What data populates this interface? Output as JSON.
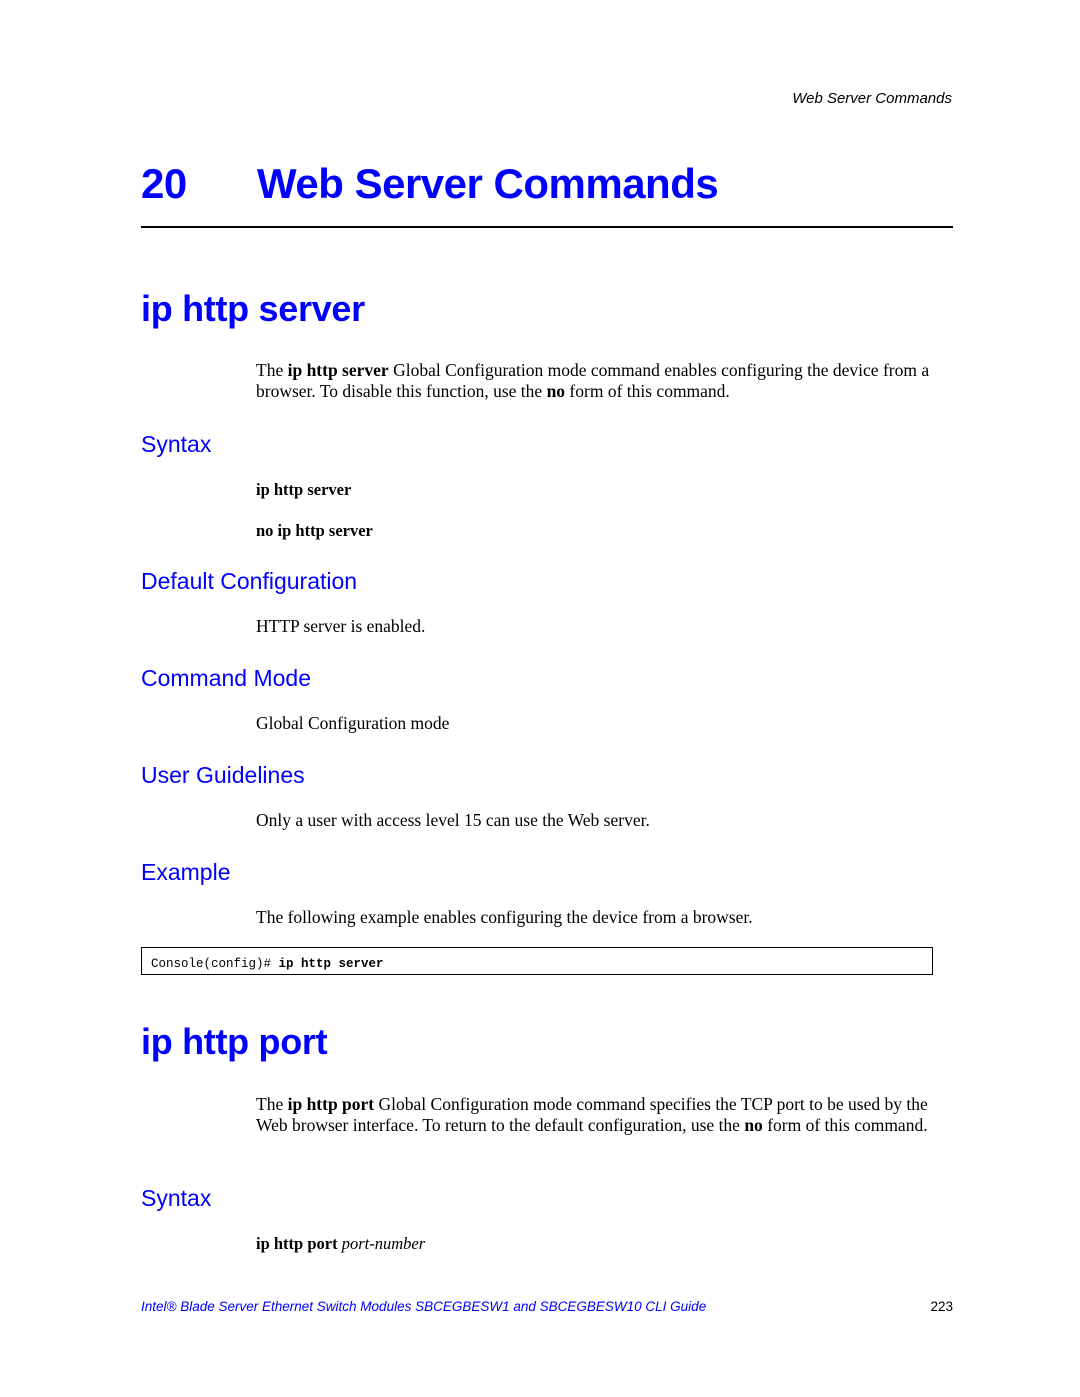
{
  "running_head": "Web Server Commands",
  "chapter": {
    "number": "20",
    "title": "Web Server Commands"
  },
  "section1": {
    "title": "ip http server",
    "intro": {
      "pre": "The ",
      "cmd": "ip http server",
      "mid": " Global Configuration mode command enables configuring the device from a browser. To disable this function, use the ",
      "no": "no",
      "post": " form of this command."
    },
    "syntax_heading": "Syntax",
    "syntax_lines": [
      "ip http server",
      "no ip http server"
    ],
    "default_heading": "Default Configuration",
    "default_text": "HTTP server is enabled.",
    "mode_heading": "Command Mode",
    "mode_text": "Global Configuration mode",
    "guidelines_heading": "User Guidelines",
    "guidelines_text": "Only a user with access level 15 can use the Web server.",
    "example_heading": "Example",
    "example_text": "The following example enables configuring the device from a browser.",
    "example_code": {
      "prompt": "Console(config)# ",
      "command": "ip http server"
    }
  },
  "section2": {
    "title": "ip http port",
    "intro": {
      "pre": "The ",
      "cmd": "ip http port",
      "mid": " Global Configuration mode command specifies the TCP port to be used by the Web browser interface. To return to the default configuration, use the ",
      "no": "no",
      "post": " form of this command."
    },
    "syntax_heading": "Syntax",
    "syntax": {
      "cmd": "ip http port",
      "param": "port-number"
    }
  },
  "footer": {
    "title": "Intel® Blade Server Ethernet Switch Modules SBCEGBESW1 and SBCEGBESW10 CLI Guide",
    "page": "223"
  }
}
